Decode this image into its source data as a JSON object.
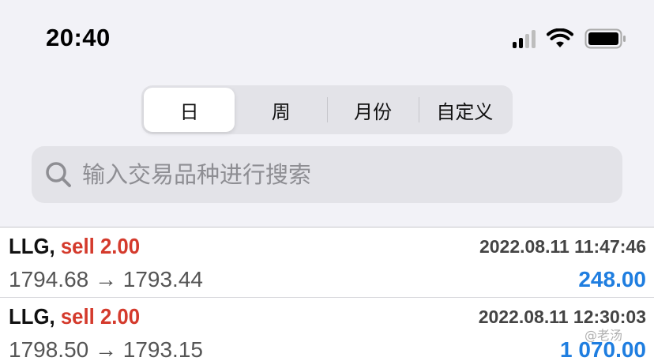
{
  "status_bar": {
    "time": "20:40"
  },
  "segmented": {
    "tabs": [
      {
        "label": "日",
        "active": true
      },
      {
        "label": "周",
        "active": false
      },
      {
        "label": "月份",
        "active": false
      },
      {
        "label": "自定义",
        "active": false
      }
    ]
  },
  "search": {
    "placeholder": "输入交易品种进行搜索"
  },
  "deals": [
    {
      "symbol": "LLG,",
      "action": "sell 2.00",
      "time": "2022.08.11 11:47:46",
      "prices": "1794.68 → 1793.44",
      "profit": "248.00"
    },
    {
      "symbol": "LLG,",
      "action": "sell 2.00",
      "time": "2022.08.11 12:30:03",
      "prices": "1798.50 → 1793.15",
      "profit": "1 070.00"
    }
  ],
  "watermark": "@老汤",
  "colors": {
    "sell": "#d43a2c",
    "profit": "#1f7ee0"
  }
}
